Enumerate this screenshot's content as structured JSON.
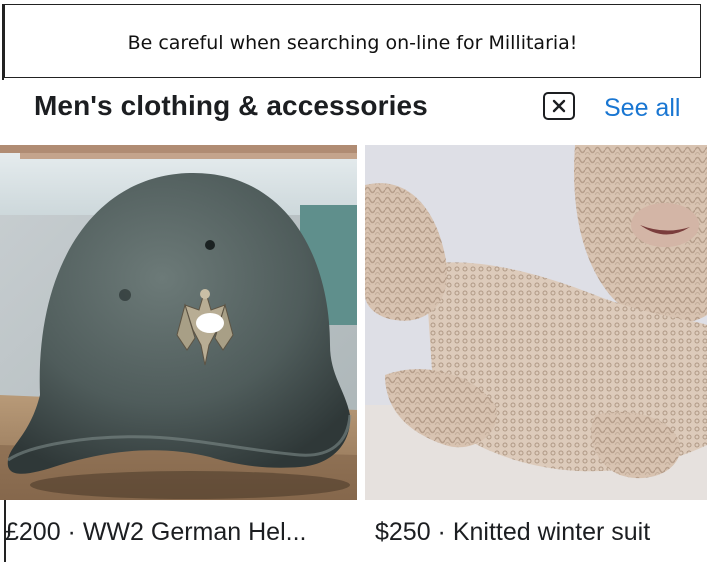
{
  "caption": "Be careful when searching on-line for Millitaria!",
  "section": {
    "title": "Men's clothing & accessories",
    "see_all": "See all"
  },
  "listings": [
    {
      "price": "£200",
      "separator": "·",
      "title": "WW2 German Hel...",
      "label": "£200 · WW2 German Hel...",
      "image": "steel-helmet-photo"
    },
    {
      "price": "$250",
      "separator": "·",
      "title": "Knitted winter suit",
      "label": "$250 · Knitted winter suit",
      "image": "knitted-suit-photo"
    }
  ],
  "colors": {
    "link": "#1976d2",
    "text": "#1c1e21"
  }
}
